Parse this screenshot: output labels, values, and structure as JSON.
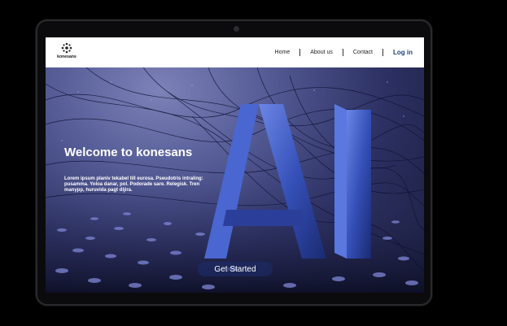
{
  "brand": {
    "name": "konesans"
  },
  "nav": {
    "items": [
      "Home",
      "About us",
      "Contact"
    ],
    "login_label": "Log in"
  },
  "hero": {
    "title": "Welcome to konesans",
    "description": "Lorem ipsum planiv tekabel till eurosa. Pseudotris intraling: pusamma. Yoloa danar, pol. Podorade sare. Relegisk. Tren manypp, huruvida pagt dijira.",
    "cta_label": "Get Started",
    "image_text": "AI"
  },
  "colors": {
    "accent": "#1f3f7c",
    "hero_dark": "#141631",
    "hero_light": "#7d82b8",
    "ai_blue": "#3a56c7"
  }
}
